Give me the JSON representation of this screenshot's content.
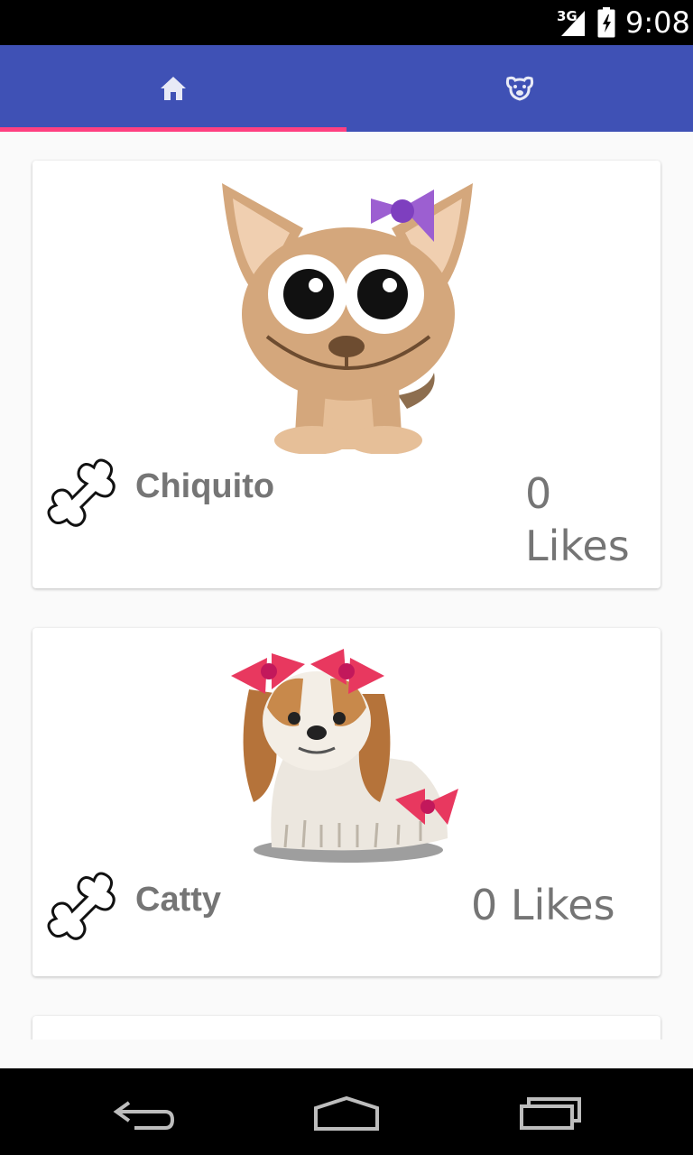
{
  "status_bar": {
    "network": "3G",
    "time": "9:08"
  },
  "tabs": [
    {
      "name": "home",
      "icon": "home-icon",
      "selected": true
    },
    {
      "name": "pets",
      "icon": "dog-face-icon",
      "selected": false
    }
  ],
  "colors": {
    "primary": "#3f51b5",
    "accent": "#ff4081",
    "text_secondary": "#757575"
  },
  "pets": [
    {
      "name": "Chiquito",
      "likes_count": "0",
      "likes_label": "Likes",
      "image": "chihuahua-illustration"
    },
    {
      "name": "Catty",
      "likes_text": "0 Likes",
      "image": "spaniel-with-bows-illustration"
    }
  ],
  "nav_buttons": [
    "back-icon",
    "home-outline-icon",
    "recents-icon"
  ]
}
